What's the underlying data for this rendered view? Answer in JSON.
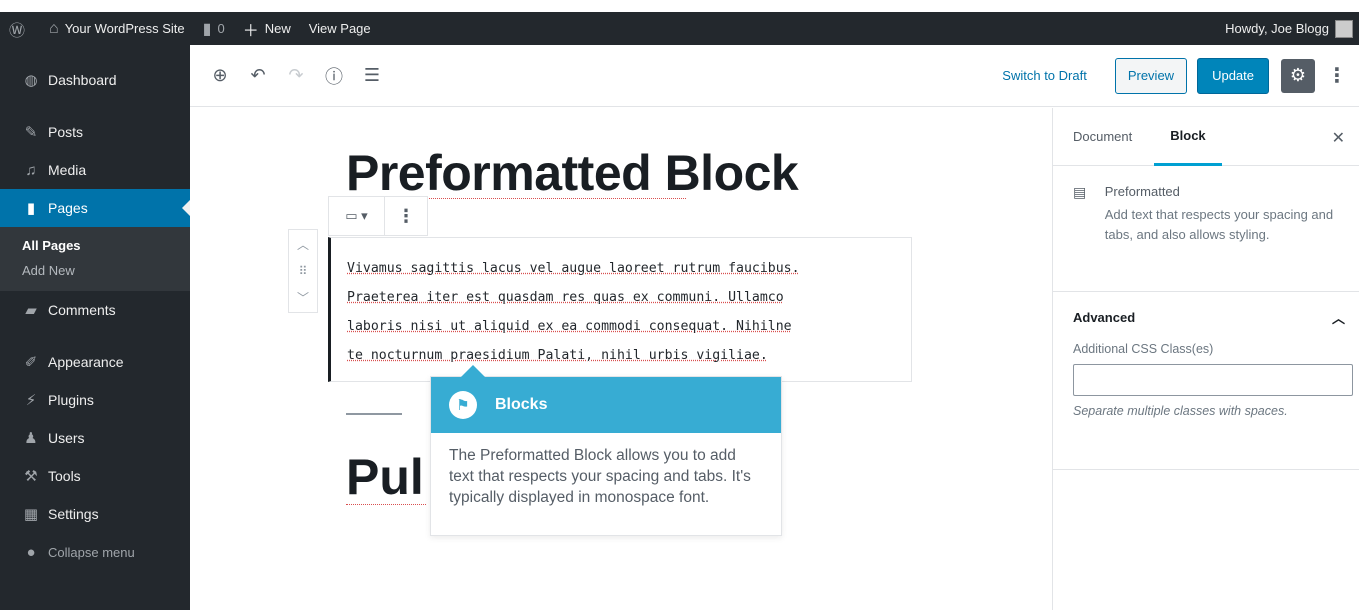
{
  "admin_bar": {
    "wp_logo": "wordpress-icon",
    "site_name": "Your WordPress Site",
    "comments_count": "0",
    "new_label": "New",
    "view_page_label": "View Page",
    "howdy": "Howdy, Joe Blogg"
  },
  "sidebar": {
    "items": [
      {
        "label": "Dashboard",
        "icon": "dashboard-icon"
      },
      {
        "label": "Posts",
        "icon": "pin-icon"
      },
      {
        "label": "Media",
        "icon": "media-icon"
      },
      {
        "label": "Pages",
        "icon": "pages-icon"
      },
      {
        "label": "Comments",
        "icon": "comments-icon"
      },
      {
        "label": "Appearance",
        "icon": "brush-icon"
      },
      {
        "label": "Plugins",
        "icon": "plugin-icon"
      },
      {
        "label": "Users",
        "icon": "users-icon"
      },
      {
        "label": "Tools",
        "icon": "wrench-icon"
      },
      {
        "label": "Settings",
        "icon": "settings-icon"
      },
      {
        "label": "Collapse menu",
        "icon": "collapse-icon"
      }
    ],
    "submenu": [
      "All Pages",
      "Add New"
    ]
  },
  "toolbar": {
    "switch_to_draft": "Switch to Draft",
    "preview": "Preview",
    "update": "Update"
  },
  "content": {
    "title": "Preformatted Block",
    "preformatted_text": "Vivamus sagittis lacus vel augue laoreet rutrum faucibus.\nPraeterea iter est quasdam res quas ex communi. Ullamco\nlaboris nisi ut aliquid ex ea commodi consequat. Nihilne\nte nocturnum praesidium Palati, nihil urbis vigiliae.",
    "next_heading": "Pul"
  },
  "tooltip": {
    "title": "Blocks",
    "body": "The Preformatted Block allows you to add text that respects your spacing and tabs. It's typically displayed in monospace font."
  },
  "inspector": {
    "tabs": [
      "Document",
      "Block"
    ],
    "block_name": "Preformatted",
    "block_description": "Add text that respects your spacing and tabs, and also allows styling.",
    "advanced_label": "Advanced",
    "css_label": "Additional CSS Class(es)",
    "css_value": "",
    "css_help": "Separate multiple classes with spaces."
  }
}
